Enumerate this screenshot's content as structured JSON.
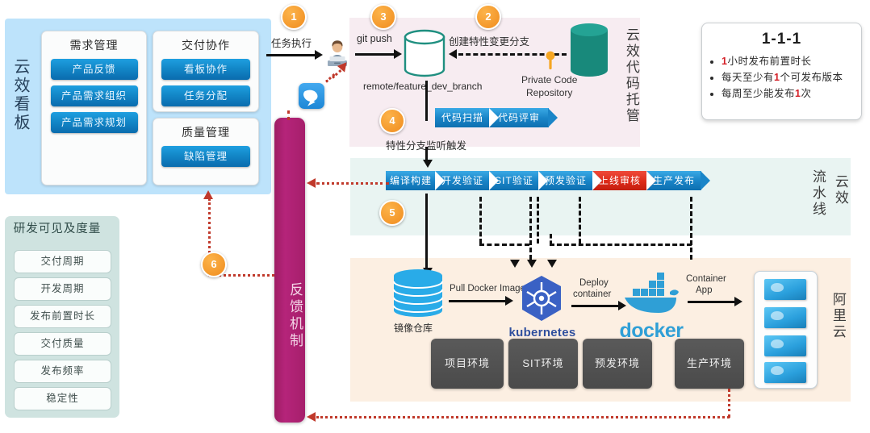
{
  "kanban": {
    "vertical_label": "云效看板",
    "cards": [
      {
        "title": "需求管理",
        "items": [
          "产品反馈",
          "产品需求组织",
          "产品需求规划"
        ]
      },
      {
        "title": "交付协作",
        "items": [
          "看板协作",
          "任务分配"
        ]
      },
      {
        "title": "质量管理",
        "items": [
          "缺陷管理"
        ]
      }
    ]
  },
  "metrics": {
    "title": "研发可见及度量",
    "items": [
      "交付周期",
      "开发周期",
      "发布前置时长",
      "交付质量",
      "发布频率",
      "稳定性"
    ]
  },
  "feedback": {
    "label": "反馈机制"
  },
  "code_hosting": {
    "vertical_label": "云效代码托管",
    "task_exec_label": "任务执行",
    "git_push_label": "git push",
    "create_branch_label": "创建特性变更分支",
    "branch_name": "remote/feature_dev_branch",
    "private_repo_line1": "Private Code",
    "private_repo_line2": "Repository",
    "trigger_label": "特性分支监听触发",
    "chevrons": [
      "代码扫描",
      "代码评审"
    ]
  },
  "pipeline": {
    "vertical_label_1": "流水线",
    "vertical_label_2": "云效",
    "stages": [
      {
        "label": "编译构建",
        "color": "blue"
      },
      {
        "label": "开发验证",
        "color": "blue"
      },
      {
        "label": "SIT验证",
        "color": "blue"
      },
      {
        "label": "预发验证",
        "color": "blue"
      },
      {
        "label": "上线审核",
        "color": "red"
      },
      {
        "label": "生产发布",
        "color": "blue"
      }
    ]
  },
  "deploy": {
    "vertical_label": "阿里云",
    "registry_label": "镜像仓库",
    "pull_label": "Pull Docker Image",
    "deploy_label_line1": "Deploy",
    "deploy_label_line2": "container",
    "container_app_line1": "Container",
    "container_app_line2": "App",
    "kubernetes_label": "kubernetes",
    "docker_label": "docker",
    "environments": [
      "项目环境",
      "SIT环境",
      "预发环境",
      "生产环境"
    ]
  },
  "callout": {
    "title": "1-1-1",
    "bullets": [
      {
        "pre": "",
        "num": "1",
        "post": "小时发布前置时长"
      },
      {
        "pre": "每天至少有",
        "num": "1",
        "post": "个可发布版本"
      },
      {
        "pre": "每周至少能发布",
        "num": "1",
        "post": "次"
      }
    ]
  },
  "steps": [
    "1",
    "2",
    "3",
    "4",
    "5",
    "6"
  ],
  "colors": {
    "kanban_bg": "#bde3fb",
    "code_bg": "#f7ecf1",
    "pipeline_bg": "#e9f4f2",
    "deploy_bg": "#fcefe2",
    "metrics_bg": "#cfe3e0",
    "feedback_bar": "#b5247a",
    "step_badge": "#f08c1e",
    "accent_red": "#d41f26",
    "stage_blue": "#1a85c8",
    "stage_red": "#dd2a18"
  }
}
